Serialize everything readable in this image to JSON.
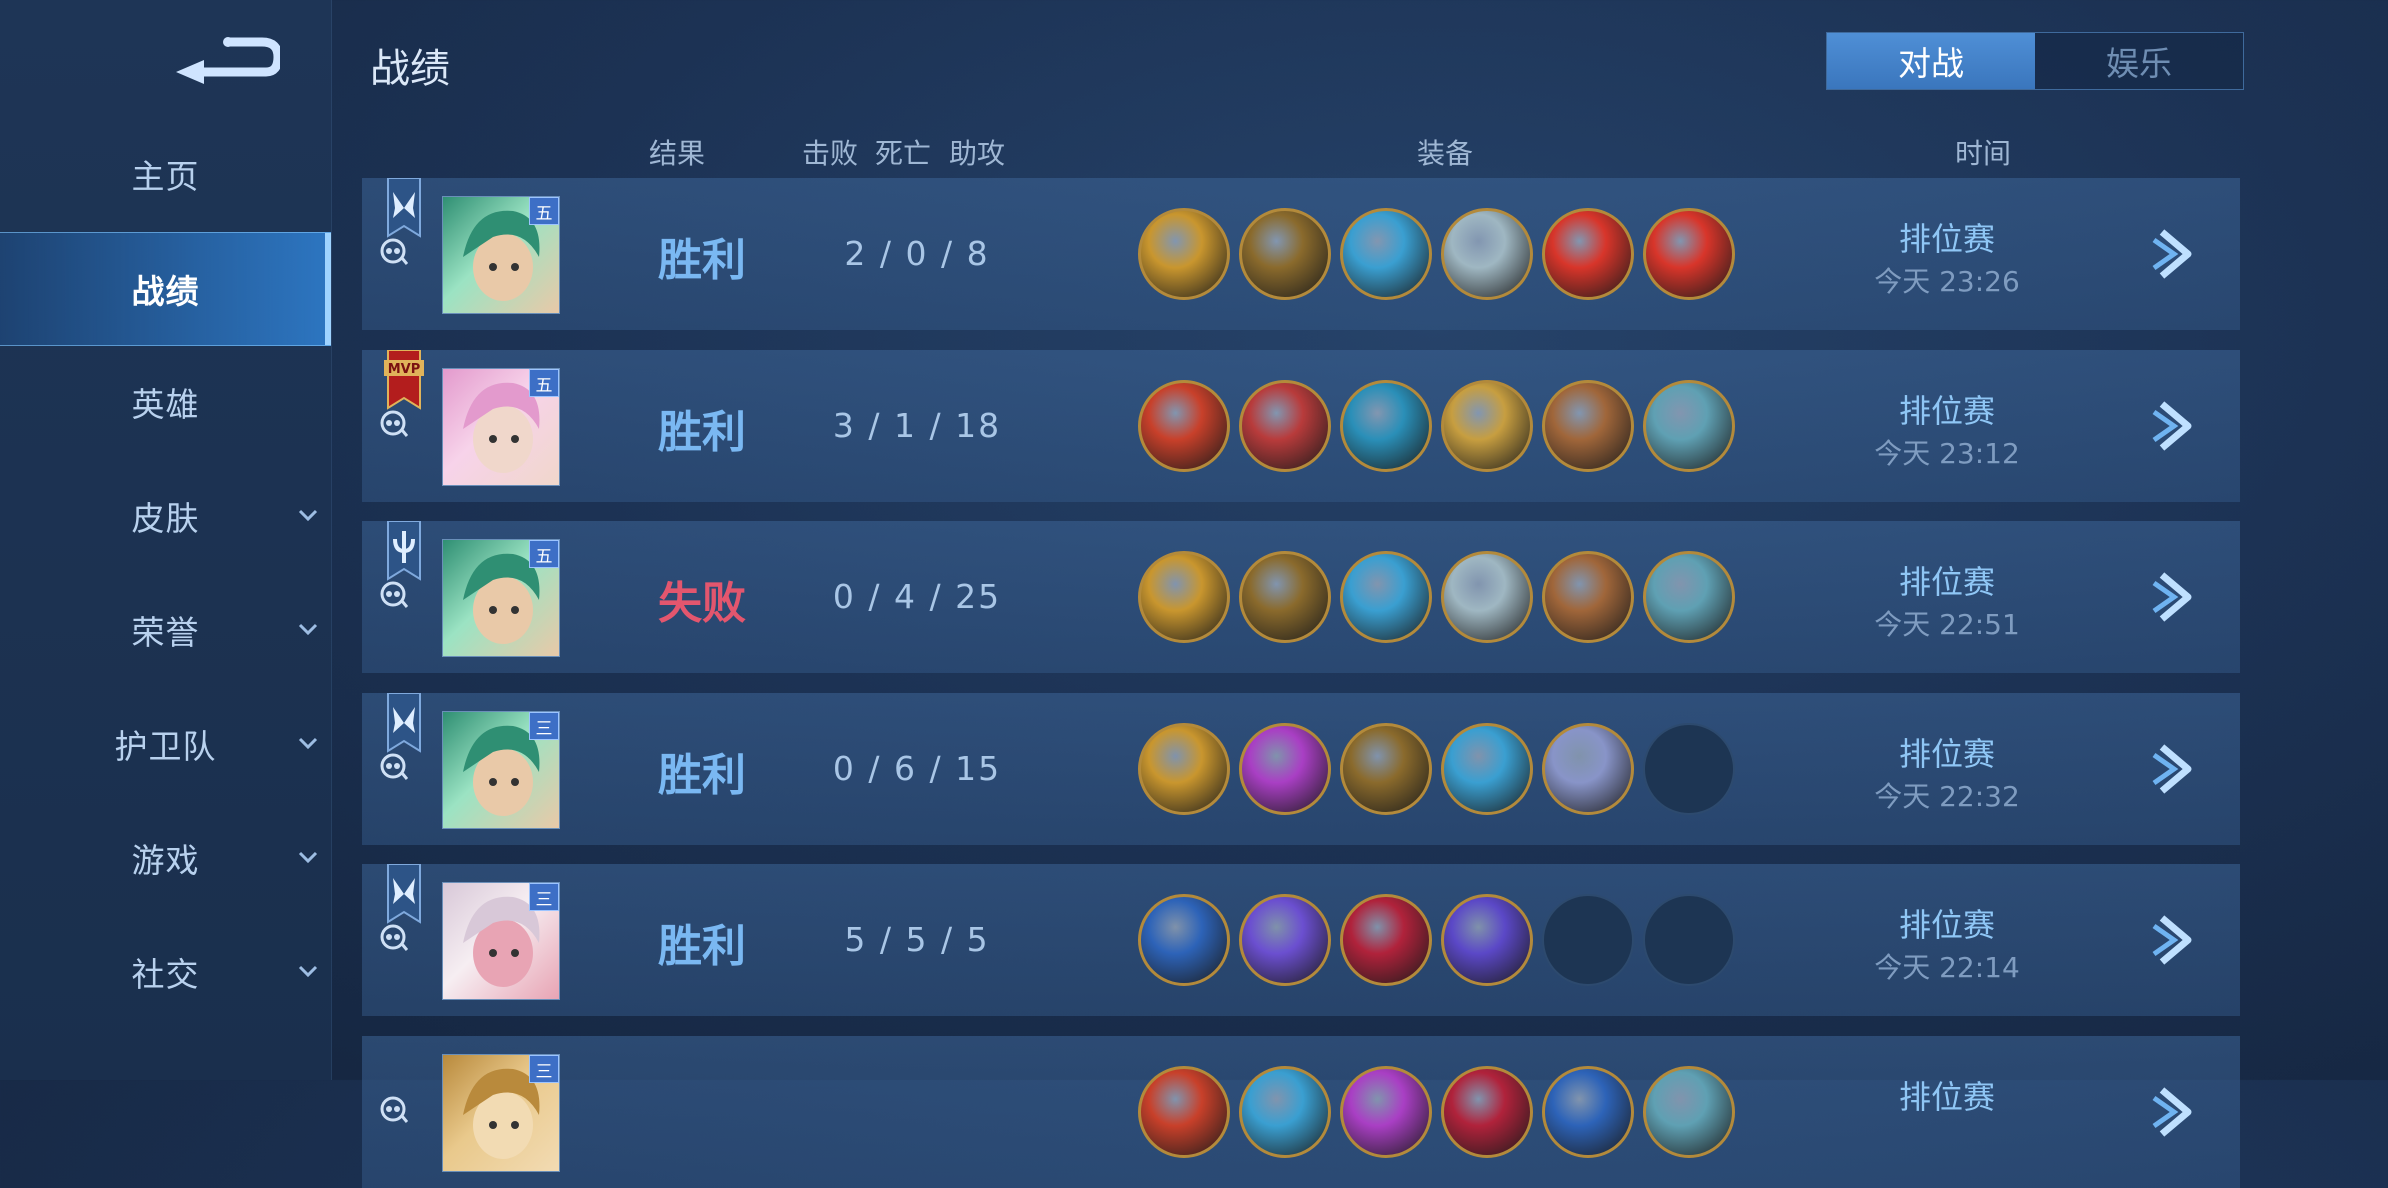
{
  "sidebar": {
    "items": [
      {
        "label": "主页",
        "chevron": false,
        "active": false
      },
      {
        "label": "战绩",
        "chevron": false,
        "active": true
      },
      {
        "label": "英雄",
        "chevron": false,
        "active": false
      },
      {
        "label": "皮肤",
        "chevron": true,
        "active": false
      },
      {
        "label": "荣誉",
        "chevron": true,
        "active": false
      },
      {
        "label": "护卫队",
        "chevron": true,
        "active": false
      },
      {
        "label": "游戏",
        "chevron": true,
        "active": false
      },
      {
        "label": "社交",
        "chevron": true,
        "active": false
      }
    ]
  },
  "header": {
    "title": "战绩",
    "tabs": [
      {
        "label": "对战",
        "selected": true
      },
      {
        "label": "娱乐",
        "selected": false
      }
    ]
  },
  "columns": {
    "result": "结果",
    "kills": "击败",
    "deaths": "死亡",
    "assists": "助攻",
    "equipment": "装备",
    "time": "时间"
  },
  "matches": [
    {
      "badge": "butterfly-icon",
      "rank": "五",
      "result": "胜利",
      "outcome": "win",
      "kda": "2 / 0 / 8",
      "mode": "排位赛",
      "time": "今天 23:26",
      "avatar": "green",
      "items": [
        "#c9962e",
        "#8a6a2c",
        "#3a9fd1",
        "#9fb7c2",
        "#d8352a",
        "#d8352a"
      ]
    },
    {
      "badge": "mvp-icon",
      "rank": "五",
      "result": "胜利",
      "outcome": "win",
      "kda": "3 / 1 / 18",
      "mode": "排位赛",
      "time": "今天 23:12",
      "avatar": "pink",
      "items": [
        "#c8402a",
        "#b83b3b",
        "#2a8fb8",
        "#c79e40",
        "#a0663a",
        "#5fa0b3"
      ]
    },
    {
      "badge": "trident-icon",
      "rank": "五",
      "result": "失败",
      "outcome": "lose",
      "kda": "0 / 4 / 25",
      "mode": "排位赛",
      "time": "今天 22:51",
      "avatar": "green",
      "items": [
        "#c9962e",
        "#8a6a2c",
        "#3a9fd1",
        "#9fb7c2",
        "#a0663a",
        "#5fa0b3"
      ]
    },
    {
      "badge": "butterfly-icon",
      "rank": "三",
      "result": "胜利",
      "outcome": "win",
      "kda": "0 / 6 / 15",
      "mode": "排位赛",
      "time": "今天 22:32",
      "avatar": "green",
      "items": [
        "#c9962e",
        "#a93fc4",
        "#8a6a2c",
        "#3a9fd1",
        "#8894c8",
        ""
      ]
    },
    {
      "badge": "butterfly-icon",
      "rank": "三",
      "result": "胜利",
      "outcome": "win",
      "kda": "5 / 5 / 5",
      "mode": "排位赛",
      "time": "今天 22:14",
      "avatar": "white",
      "items": [
        "#2d63b8",
        "#6b4fd0",
        "#b0223b",
        "#5b48c7",
        "",
        ""
      ]
    },
    {
      "badge": "",
      "rank": "三",
      "result": "",
      "outcome": "win",
      "kda": "",
      "mode": "排位赛",
      "time": "",
      "avatar": "gold",
      "items": [
        "#c8402a",
        "#3a9fd1",
        "#a93fc4",
        "#b0223b",
        "#2d63b8",
        "#5fa0b3"
      ]
    }
  ]
}
